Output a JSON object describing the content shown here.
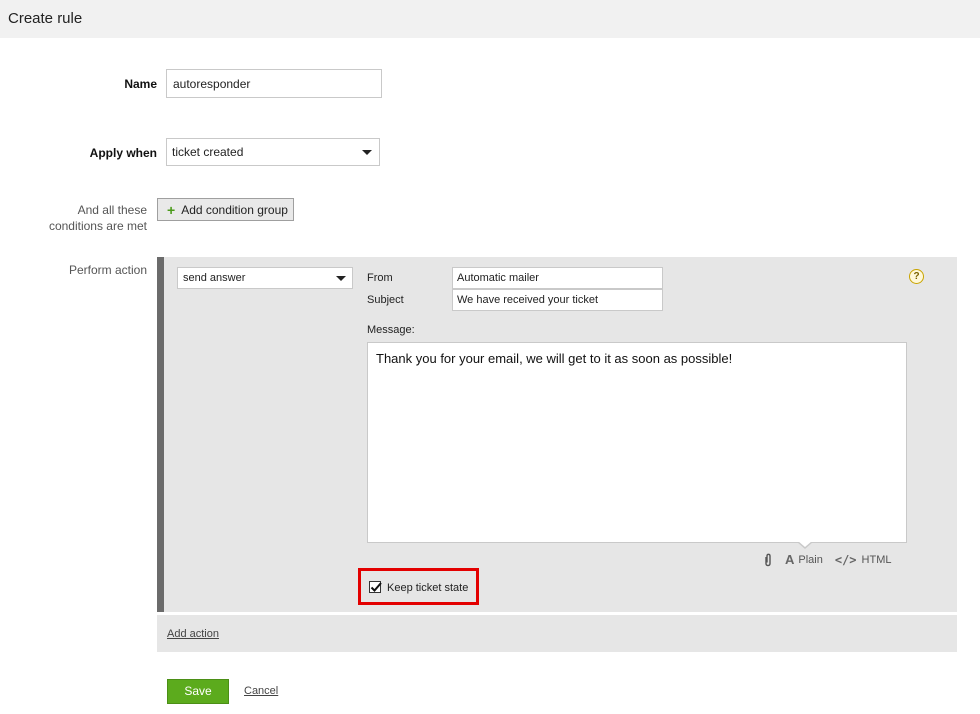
{
  "header": {
    "title": "Create rule"
  },
  "form": {
    "name_label": "Name",
    "name_value": "autoresponder",
    "apply_when_label": "Apply when",
    "apply_when_value": "ticket created",
    "conditions_label_line1": "And all these",
    "conditions_label_line2": "conditions are met",
    "add_condition_group_label": "Add condition group",
    "perform_action_label": "Perform action"
  },
  "action": {
    "type_value": "send answer",
    "from_label": "From",
    "from_value": "Automatic mailer",
    "subject_label": "Subject",
    "subject_value": "We have received your ticket",
    "message_label": "Message:",
    "message_value": "Thank you for your email, we will get to it as soon as possible!",
    "format_plain_label": "Plain",
    "format_html_label": "HTML",
    "keep_ticket_state_label": "Keep ticket state",
    "keep_ticket_state_checked": true,
    "help_icon_glyph": "?"
  },
  "footer": {
    "add_action_label": "Add action",
    "save_label": "Save",
    "cancel_label": "Cancel"
  },
  "colors": {
    "save_button": "#5cab1d",
    "highlight": "#e30000",
    "action_panel": "#e6e6e6",
    "action_bar": "#6b6b6b"
  }
}
